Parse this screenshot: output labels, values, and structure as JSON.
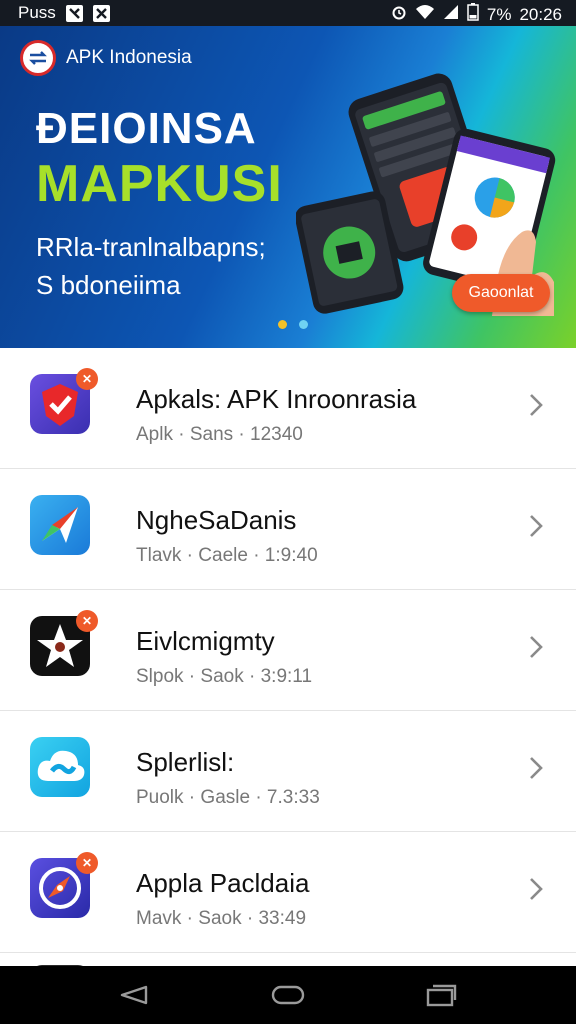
{
  "status_bar": {
    "carrier": "Puss",
    "battery": "7%",
    "time": "20:26"
  },
  "banner": {
    "brand": "APK Indonesia",
    "headline_line1": "ÐEIOINSA",
    "headline_line2": "MAPKUSI",
    "subtitle_line1": "RRla-tranlnalbapns;",
    "subtitle_line2": "S bdoneiima",
    "cta_label": "Gaoonlat",
    "colors": {
      "headline_accent": "#a7e02a",
      "cta": "#ef5a2a"
    }
  },
  "apps": [
    {
      "title": "Apkals: APK Inroonrasia",
      "meta": "Aplk · Sans · 12340",
      "icon": "shield-check-icon",
      "color": "#5a3fd0"
    },
    {
      "title": "NgheSaDanis",
      "meta": "Tlavk · Caele · 1:9:40",
      "icon": "paper-plane-icon",
      "color": "#2aa0e8"
    },
    {
      "title": "Eivlcmigmty",
      "meta": "Slpok · Saok · 3:9:11",
      "icon": "star-icon",
      "color": "#111111"
    },
    {
      "title": "Splerlisl:",
      "meta": "Puolk · Gasle · 7.3:33",
      "icon": "cloud-link-icon",
      "color": "#18b8e8"
    },
    {
      "title": "Appla Pacldaia",
      "meta": "Mavk · Saok · 33:49",
      "icon": "compass-icon",
      "color": "#4a3fc8"
    }
  ]
}
